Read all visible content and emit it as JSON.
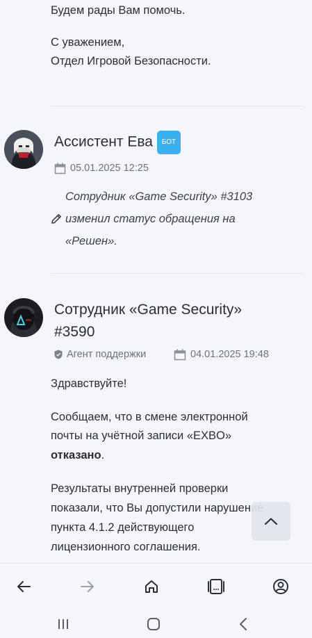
{
  "message_prev": {
    "line1": "Будем рады Вам помочь.",
    "sign1": "С уважением,",
    "sign2": "Отдел Игровой Безопасности."
  },
  "bot_post": {
    "author": "Ассистент Ева",
    "badge": "БОТ",
    "date": "05.01.2025 12:25",
    "text_line1": "Сотрудник «Game Security» #3103",
    "text_line2": "изменил статус обращения на",
    "text_line3": "«Решен»."
  },
  "staff_post": {
    "author_line1": "Сотрудник «Game Security»",
    "author_line2": "#3590",
    "role": "Агент поддержки",
    "date": "04.01.2025 19:48",
    "greeting": "Здравствуйте!",
    "p1_line1": "Сообщаем, что в смене электронной",
    "p1_line2": "почты на учётной записи «EXBO»",
    "p1_bold": "отказано",
    "p1_end": ".",
    "p2_line1": "Результаты внутренней проверки",
    "p2_line2": "показали, что Вы допустили нарушение",
    "p2_line3": "пункта 4.1.2 действующего",
    "p2_line4": "лицензионного соглашения."
  },
  "colors": {
    "bot_badge": "#3bb0ef",
    "background": "#f4f6fa",
    "text": "#2a2e3a",
    "meta": "#6b7280"
  },
  "icons": {
    "calendar": "calendar-icon",
    "pencil": "pencil-icon",
    "shield": "shield-icon",
    "back": "arrow-left-icon",
    "forward": "arrow-right-icon",
    "home": "home-icon",
    "tabs": "tabs-icon",
    "account": "account-icon",
    "scroll_top": "chevron-up-icon"
  }
}
